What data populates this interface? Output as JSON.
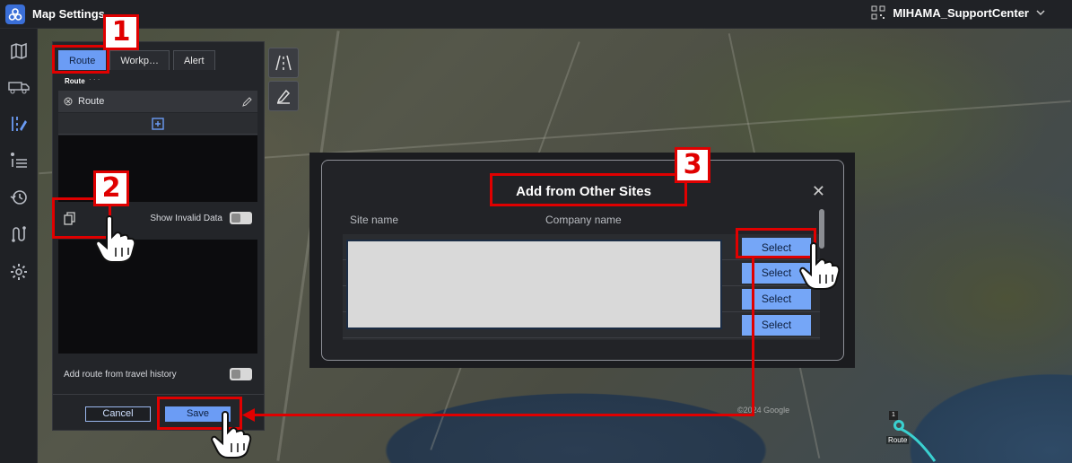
{
  "header": {
    "app_title": "Map Settings",
    "site_name": "MIHAMA_SupportCenter"
  },
  "rail_icons": [
    "map-icon",
    "truck-icon",
    "route-edit-icon",
    "list-icon",
    "history-icon",
    "path-icon",
    "gear-icon"
  ],
  "panel": {
    "tabs": [
      {
        "label": "Route",
        "active": true
      },
      {
        "label": "Workp…",
        "active": false
      },
      {
        "label": "Alert",
        "active": false
      }
    ],
    "tab_caption": "Route",
    "route_header": "Route",
    "show_invalid_label": "Show Invalid Data",
    "add_history_label": "Add route from travel history",
    "cancel_label": "Cancel",
    "save_label": "Save"
  },
  "dialog": {
    "title": "Add from Other Sites",
    "columns": [
      "Site name",
      "Company name"
    ],
    "select_label": "Select",
    "rows": 4
  },
  "map": {
    "watermark": "©2024 Google",
    "marker_label": "Route",
    "marker_number": "1"
  },
  "annotations": [
    "1",
    "2",
    "3"
  ],
  "colors": {
    "accent": "#6b9cf5",
    "annotation": "#e00000"
  }
}
